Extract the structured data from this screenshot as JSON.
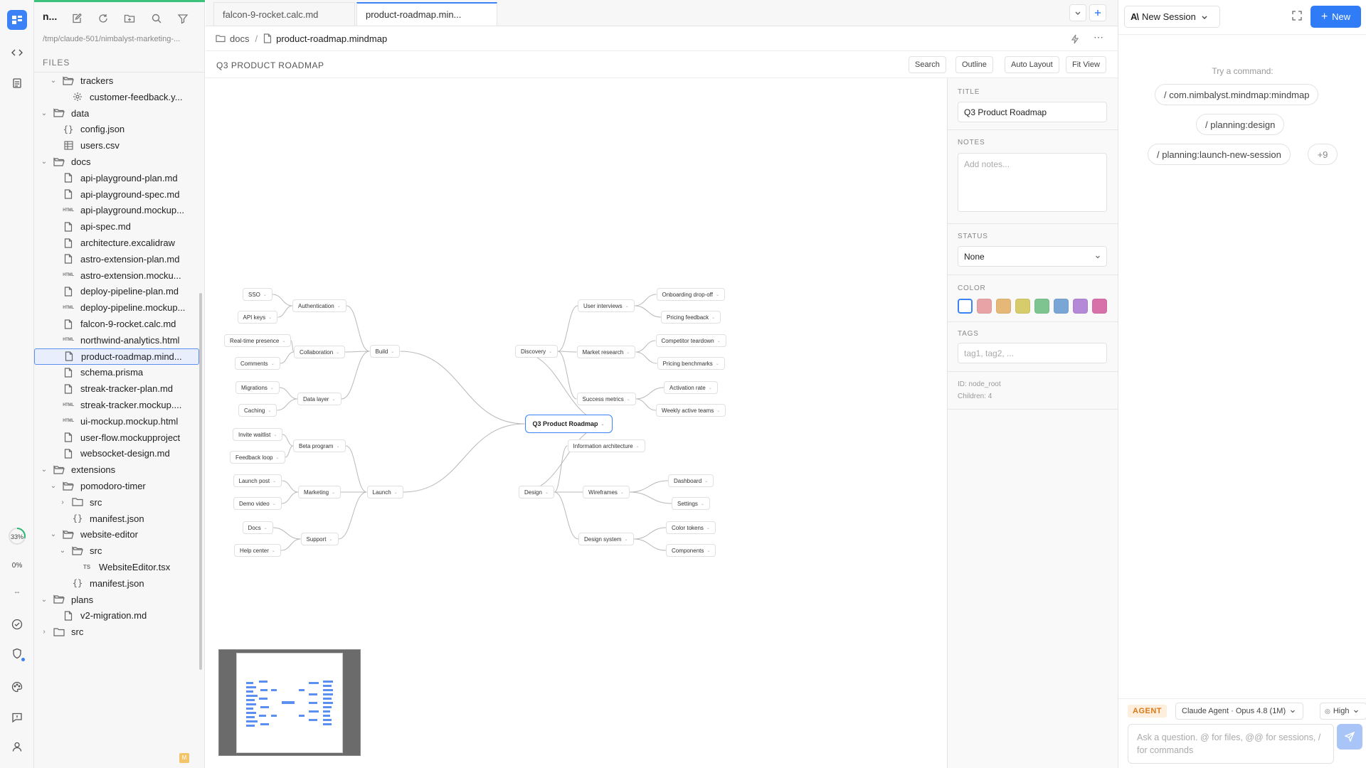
{
  "rail": {
    "progress_33": "33%",
    "progress_0": "0%",
    "dashes": "--"
  },
  "explorer": {
    "project_name": "n...",
    "path": "/tmp/claude-501/nimbalyst-marketing-...",
    "files_label": "FILES",
    "badge": "M",
    "rows": [
      {
        "label": "trackers",
        "type": "folder",
        "depth": 1,
        "open": true
      },
      {
        "label": "customer-feedback.y...",
        "type": "gear",
        "depth": 2
      },
      {
        "label": "data",
        "type": "folder",
        "depth": 0,
        "open": true
      },
      {
        "label": "config.json",
        "type": "json",
        "depth": 1
      },
      {
        "label": "users.csv",
        "type": "table",
        "depth": 1
      },
      {
        "label": "docs",
        "type": "folder",
        "depth": 0,
        "open": true
      },
      {
        "label": "api-playground-plan.md",
        "type": "doc",
        "depth": 1
      },
      {
        "label": "api-playground-spec.md",
        "type": "doc",
        "depth": 1
      },
      {
        "label": "api-playground.mockup...",
        "type": "html",
        "depth": 1
      },
      {
        "label": "api-spec.md",
        "type": "doc",
        "depth": 1
      },
      {
        "label": "architecture.excalidraw",
        "type": "doc",
        "depth": 1
      },
      {
        "label": "astro-extension-plan.md",
        "type": "doc",
        "depth": 1
      },
      {
        "label": "astro-extension.mocku...",
        "type": "html",
        "depth": 1
      },
      {
        "label": "deploy-pipeline-plan.md",
        "type": "doc",
        "depth": 1
      },
      {
        "label": "deploy-pipeline.mockup...",
        "type": "html",
        "depth": 1
      },
      {
        "label": "falcon-9-rocket.calc.md",
        "type": "doc",
        "depth": 1
      },
      {
        "label": "northwind-analytics.html",
        "type": "html",
        "depth": 1
      },
      {
        "label": "product-roadmap.mind...",
        "type": "doc",
        "depth": 1,
        "selected": true
      },
      {
        "label": "schema.prisma",
        "type": "doc",
        "depth": 1
      },
      {
        "label": "streak-tracker-plan.md",
        "type": "doc",
        "depth": 1
      },
      {
        "label": "streak-tracker.mockup....",
        "type": "html",
        "depth": 1
      },
      {
        "label": "ui-mockup.mockup.html",
        "type": "html",
        "depth": 1
      },
      {
        "label": "user-flow.mockupproject",
        "type": "doc",
        "depth": 1
      },
      {
        "label": "websocket-design.md",
        "type": "doc",
        "depth": 1
      },
      {
        "label": "extensions",
        "type": "folder",
        "depth": 0,
        "open": true
      },
      {
        "label": "pomodoro-timer",
        "type": "folder",
        "depth": 1,
        "open": true
      },
      {
        "label": "src",
        "type": "folder",
        "depth": 2,
        "open": false
      },
      {
        "label": "manifest.json",
        "type": "json",
        "depth": 2
      },
      {
        "label": "website-editor",
        "type": "folder",
        "depth": 1,
        "open": true
      },
      {
        "label": "src",
        "type": "folder",
        "depth": 2,
        "open": true
      },
      {
        "label": "WebsiteEditor.tsx",
        "type": "ts",
        "depth": 3
      },
      {
        "label": "manifest.json",
        "type": "json",
        "depth": 2
      },
      {
        "label": "plans",
        "type": "folder",
        "depth": 0,
        "open": true
      },
      {
        "label": "v2-migration.md",
        "type": "doc",
        "depth": 1
      },
      {
        "label": "src",
        "type": "folder",
        "depth": 0,
        "open": false
      }
    ]
  },
  "tabs": [
    {
      "label": "falcon-9-rocket.calc.md",
      "active": false
    },
    {
      "label": "product-roadmap.min...",
      "active": true
    }
  ],
  "breadcrumb": {
    "folder": "docs",
    "sep": "/",
    "file": "product-roadmap.mindmap"
  },
  "toolbar": {
    "title": "Q3 PRODUCT ROADMAP",
    "search": "Search",
    "outline": "Outline",
    "auto_layout": "Auto Layout",
    "fit_view": "Fit View"
  },
  "mindmap": {
    "root": "Q3 Product Roadmap",
    "left": [
      {
        "label": "Build",
        "children": [
          {
            "label": "Authentication",
            "children": [
              "SSO",
              "API keys"
            ]
          },
          {
            "label": "Collaboration",
            "children": [
              "Real-time presence",
              "Comments"
            ]
          },
          {
            "label": "Data layer",
            "children": [
              "Migrations",
              "Caching"
            ]
          }
        ]
      },
      {
        "label": "Launch",
        "children": [
          {
            "label": "Beta program",
            "children": [
              "Invite waitlist",
              "Feedback loop"
            ]
          },
          {
            "label": "Marketing",
            "children": [
              "Launch post",
              "Demo video"
            ]
          },
          {
            "label": "Support",
            "children": [
              "Docs",
              "Help center"
            ]
          }
        ]
      }
    ],
    "right": [
      {
        "label": "Discovery",
        "children": [
          {
            "label": "User interviews",
            "children": [
              "Onboarding drop-off",
              "Pricing feedback"
            ]
          },
          {
            "label": "Market research",
            "children": [
              "Competitor teardown",
              "Pricing benchmarks"
            ]
          },
          {
            "label": "Success metrics",
            "children": [
              "Activation rate",
              "Weekly active teams"
            ]
          }
        ]
      },
      {
        "label": "Design",
        "children": [
          {
            "label": "Information architecture",
            "children": []
          },
          {
            "label": "Wireframes",
            "children": [
              "Dashboard",
              "Settings"
            ]
          },
          {
            "label": "Design system",
            "children": [
              "Color tokens",
              "Components"
            ]
          }
        ]
      }
    ]
  },
  "props": {
    "title_label": "TITLE",
    "title_value": "Q3 Product Roadmap",
    "notes_label": "NOTES",
    "notes_placeholder": "Add notes...",
    "status_label": "STATUS",
    "status_value": "None",
    "color_label": "COLOR",
    "colors": [
      "#ffffff",
      "#e8a3a6",
      "#e5b877",
      "#d6cc6b",
      "#7ec490",
      "#7aa6d6",
      "#b48ad8",
      "#d870aa"
    ],
    "tags_label": "TAGS",
    "tags_placeholder": "tag1, tag2, ...",
    "id_text": "ID: node_root",
    "children_text": "Children: 4"
  },
  "chat": {
    "session_label": "New Session",
    "new_label": "New",
    "try_label": "Try a command:",
    "commands": [
      "/ com.nimbalyst.mindmap:mindmap",
      "/ planning:design",
      "/ planning:launch-new-session"
    ],
    "more": "+9",
    "agent_badge": "AGENT",
    "model": "Claude Agent · Opus 4.8 (1M)",
    "effort": "High",
    "input_placeholder": "Ask a question. @ for files, @@ for sessions, / for commands"
  }
}
